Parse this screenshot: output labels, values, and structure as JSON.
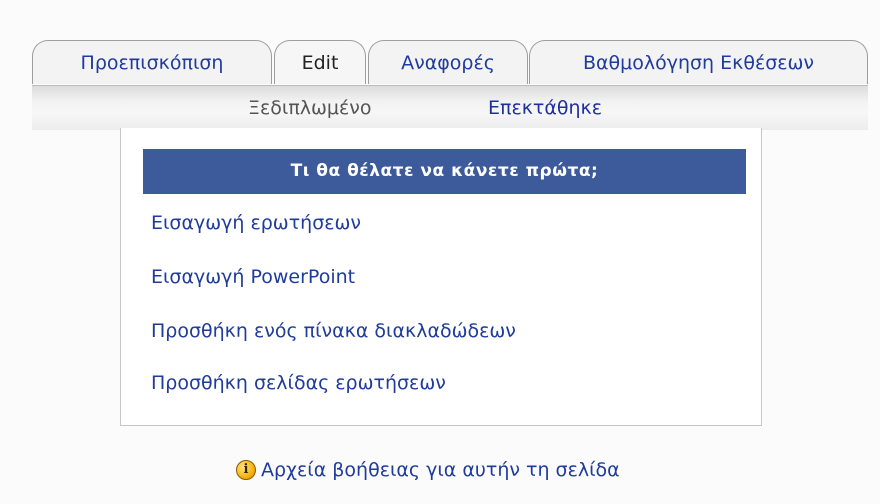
{
  "tabs": [
    {
      "label": "Προεπισκόπιση",
      "active": false
    },
    {
      "label": "Edit",
      "active": true
    },
    {
      "label": "Αναφορές",
      "active": false
    },
    {
      "label": "Βαθμολόγηση Εκθέσεων",
      "active": false
    }
  ],
  "subtabs": {
    "collapsed": "Ξεδιπλωμένο",
    "expanded": "Επεκτάθηκε"
  },
  "panel": {
    "header": "Τι θα θέλατε να κάνετε πρώτα;",
    "options": [
      "Εισαγωγή ερωτήσεων",
      "Εισαγωγή PowerPoint",
      "Προσθήκη ενός πίνακα διακλαδώδεων",
      "Προσθήκη σελίδας ερωτήσεων"
    ]
  },
  "help": {
    "icon": "info-icon",
    "icon_glyph": "i",
    "link": "Αρχεία βοήθειας για αυτήν τη σελίδα"
  },
  "colors": {
    "link": "#1f3b9c",
    "header_bg": "#3d5a9b",
    "header_text": "#ffffff"
  }
}
